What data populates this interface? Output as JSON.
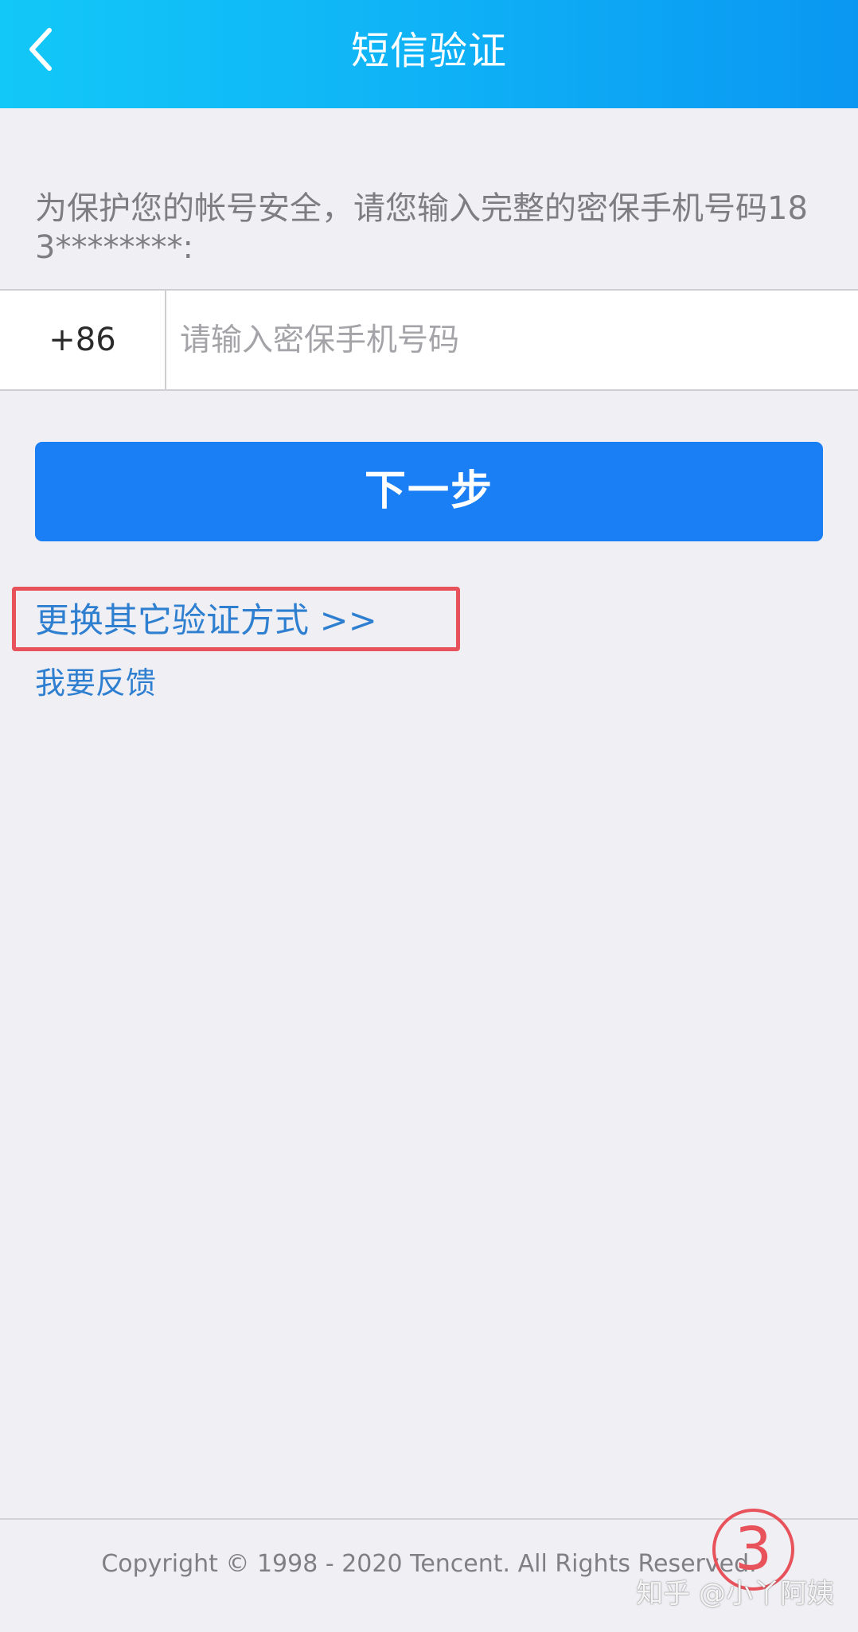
{
  "nav": {
    "title": "短信验证",
    "back_icon": "chevron-left-icon"
  },
  "hint": "为保护您的帐号安全，请您输入完整的密保手机号码183********:",
  "phone": {
    "country_code": "+86",
    "placeholder": "请输入密保手机号码",
    "value": ""
  },
  "next_button": "下一步",
  "links": {
    "alt_method": "更换其它验证方式 >>",
    "feedback": "我要反馈"
  },
  "footer": "Copyright © 1998 - 2020 Tencent. All Rights Reserved.",
  "annotations": {
    "step_number": "3",
    "highlight_color": "#e8525b"
  },
  "watermark": "知乎 @小丫阿姨",
  "colors": {
    "accent": "#1a7ff5",
    "link": "#2f7fd1",
    "background": "#efeff4"
  }
}
